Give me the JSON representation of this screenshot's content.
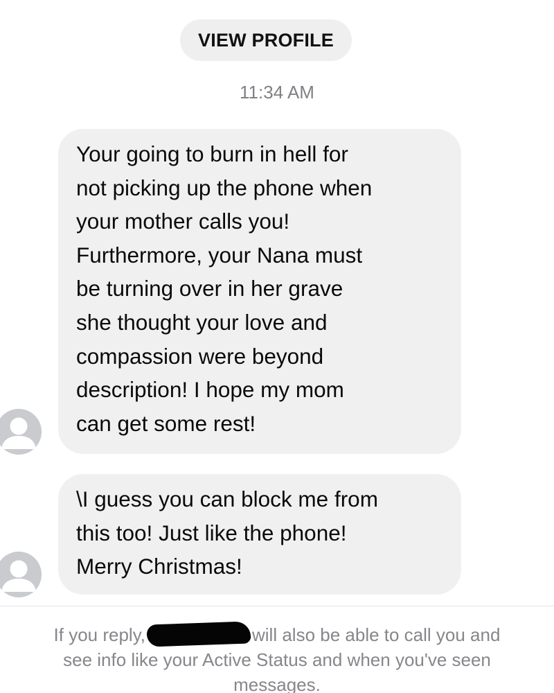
{
  "header": {
    "view_profile_label": "VIEW PROFILE"
  },
  "thread": {
    "timestamp": "11:34 AM",
    "messages": [
      {
        "lines": [
          "Your going to burn in hell for",
          "not picking up the phone when",
          "your mother calls you!",
          "Furthermore, your Nana must",
          "be turning over in her grave",
          "she thought your love and",
          "compassion were beyond",
          "description!  I hope my mom",
          "can get some rest!"
        ]
      },
      {
        "lines": [
          "\\I guess you can block me from",
          "this too!  Just like the phone!",
          "Merry Christmas!"
        ]
      }
    ]
  },
  "footer": {
    "notice_start": "If you reply,",
    "notice_line1_end": "will also be able to call you and",
    "notice_line2": "see info like your Active Status and when you've seen",
    "notice_line3": "messages."
  },
  "icons": {
    "avatar": "default-avatar-icon",
    "redaction": "redaction-mark"
  },
  "colors": {
    "bubble_bg": "#f0f0f1",
    "pill_bg": "#efeff0",
    "muted_text": "#808085",
    "avatar_bg": "#c9cbcf"
  }
}
